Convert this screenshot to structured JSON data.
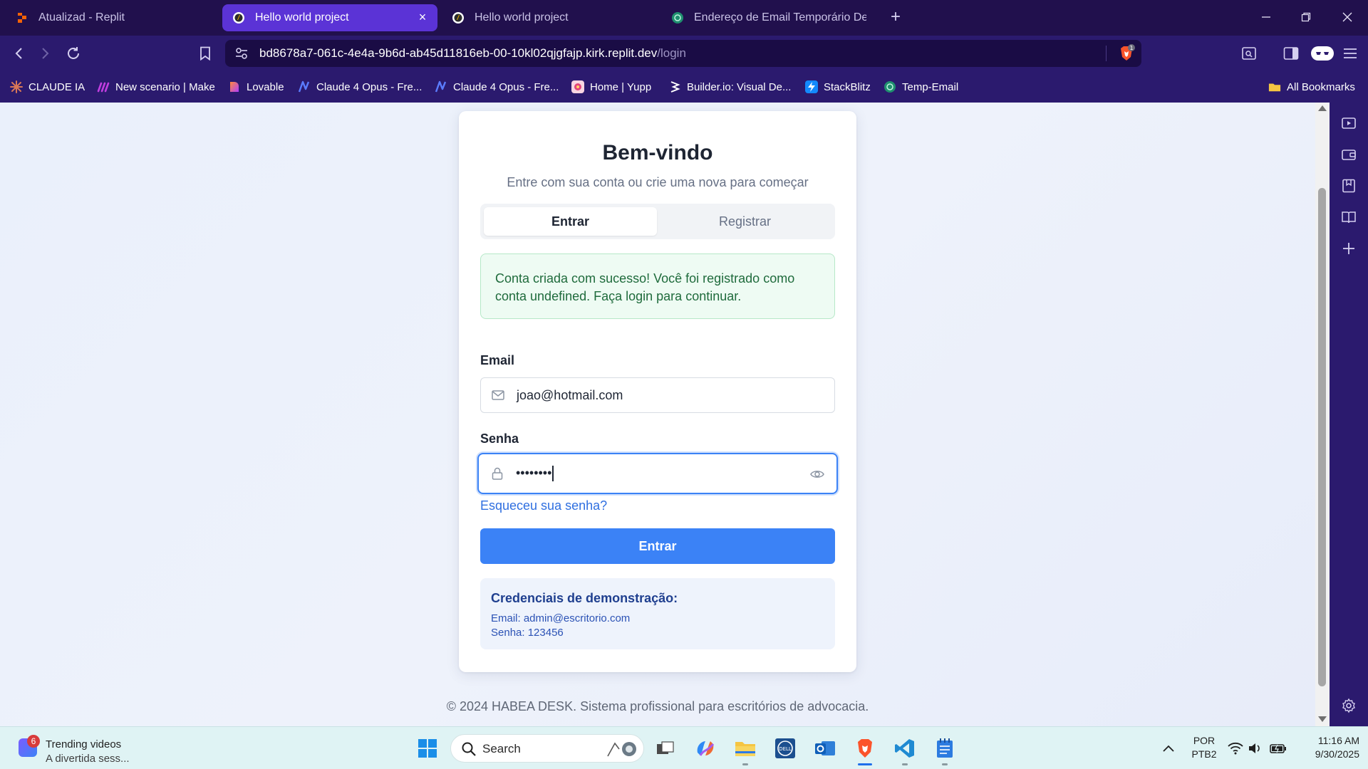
{
  "browser": {
    "tabs": [
      {
        "label": "Atualizad - Replit",
        "active": false
      },
      {
        "label": "Hello world project",
        "active": true
      },
      {
        "label": "Hello world project",
        "active": false
      },
      {
        "label": "Endereço de Email Temporário Desca",
        "active": false
      }
    ],
    "new_tab_label": "+",
    "close_tab_label": "×",
    "url_host": "bd8678a7-061c-4e4a-9b6d-ab45d11816eb-00-10kl02qjgfajp.kirk.replit.dev",
    "url_path": "/login",
    "shield_count": "1",
    "bookmarks": [
      {
        "label": "CLAUDE IA",
        "icon": "claude-icon",
        "color": "#d97757"
      },
      {
        "label": "New scenario | Make",
        "icon": "make-icon",
        "color": "#9b2fd1"
      },
      {
        "label": "Lovable",
        "icon": "lovable-icon",
        "color": "#ff4f7a"
      },
      {
        "label": "Claude 4 Opus - Fre...",
        "icon": "n-icon",
        "color": "#3b6cf6"
      },
      {
        "label": "Claude 4 Opus - Fre...",
        "icon": "n-icon",
        "color": "#3b6cf6"
      },
      {
        "label": "Home | Yupp",
        "icon": "yupp-icon",
        "color": "#f4a3c0"
      },
      {
        "label": "Builder.io: Visual De...",
        "icon": "builder-icon",
        "color": "#1f1f1f"
      },
      {
        "label": "StackBlitz",
        "icon": "stackblitz-icon",
        "color": "#1389fd"
      },
      {
        "label": "Temp-Email",
        "icon": "temp-email-icon",
        "color": "#1f8f6f"
      }
    ],
    "all_bookmarks": "All Bookmarks"
  },
  "login": {
    "title": "Bem-vindo",
    "subtitle": "Entre com sua conta ou crie uma nova para começar",
    "tab_login": "Entrar",
    "tab_register": "Registrar",
    "success_message": "Conta criada com sucesso! Você foi registrado como conta undefined. Faça login para continuar.",
    "email_label": "Email",
    "email_value": "joao@hotmail.com",
    "password_label": "Senha",
    "password_value": "••••••••",
    "forgot_link": "Esqueceu sua senha?",
    "submit_label": "Entrar",
    "demo_title": "Credenciais de demonstração:",
    "demo_email": "Email: admin@escritorio.com",
    "demo_password": "Senha: 123456",
    "accent_color": "#3b82f6"
  },
  "footer": {
    "text": "© 2024 HABEA DESK. Sistema profissional para escritórios de advocacia."
  },
  "taskbar": {
    "widget_badge": "6",
    "widget_title": "Trending videos",
    "widget_subtitle": "A divertida sess...",
    "search_label": "Search",
    "lang_line1": "POR",
    "lang_line2": "PTB2",
    "time": "11:16 AM",
    "date": "9/30/2025"
  }
}
